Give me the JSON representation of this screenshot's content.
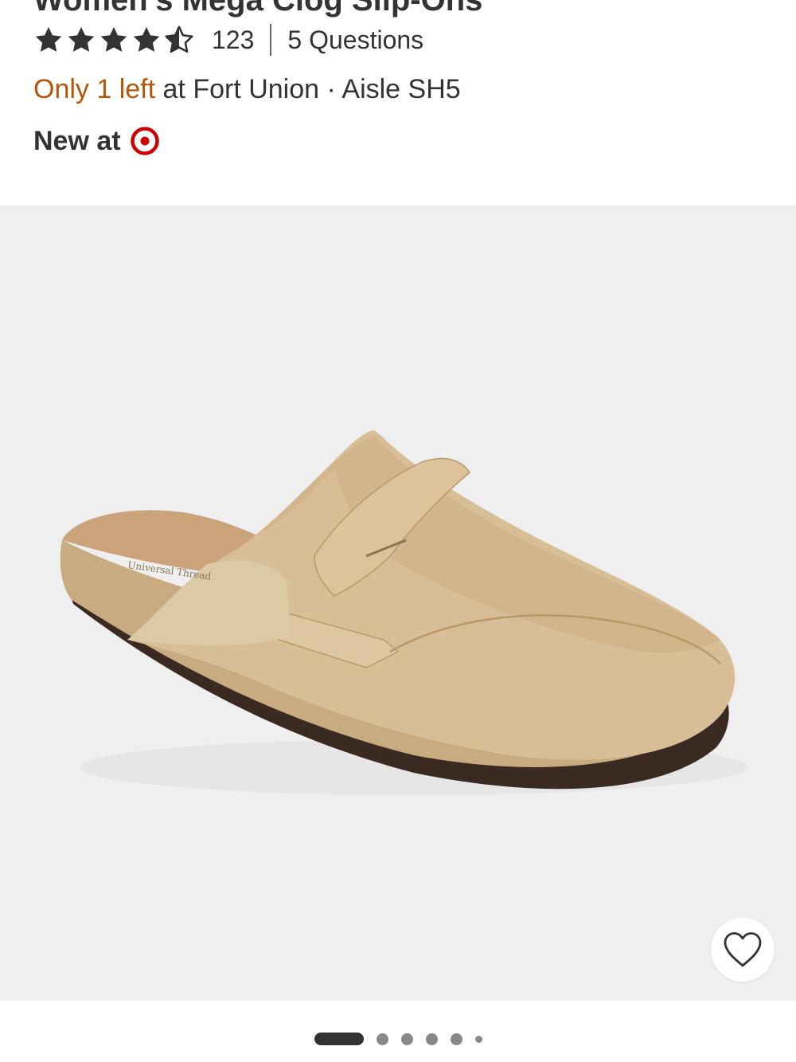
{
  "product": {
    "title_fragment": "Women's Mega Clog Slip-Ons",
    "rating_value": 4.5,
    "review_count": "123",
    "questions": "5 Questions",
    "stock": {
      "highlight": "Only 1 left",
      "rest": " at Fort Union · Aisle SH5"
    },
    "new_label": "New at",
    "accent_color": "#cc0000",
    "stock_color": "#b5560a"
  },
  "gallery": {
    "total_images": 6,
    "active_index": 0,
    "favorite_icon": "heart-outline-icon"
  }
}
